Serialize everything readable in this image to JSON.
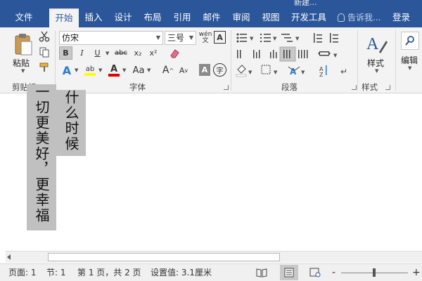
{
  "window": {
    "doc_title": "新建..."
  },
  "tabs": [
    {
      "label": "文件",
      "active": false
    },
    {
      "label": "开始",
      "active": true
    },
    {
      "label": "插入",
      "active": false
    },
    {
      "label": "设计",
      "active": false
    },
    {
      "label": "布局",
      "active": false
    },
    {
      "label": "引用",
      "active": false
    },
    {
      "label": "邮件",
      "active": false
    },
    {
      "label": "审阅",
      "active": false
    },
    {
      "label": "视图",
      "active": false
    },
    {
      "label": "开发工具",
      "active": false
    }
  ],
  "tell_me": {
    "text": "告诉我..."
  },
  "login": {
    "label": "登录"
  },
  "ribbon": {
    "clipboard": {
      "group_label": "剪贴板",
      "paste_label": "粘贴"
    },
    "font": {
      "group_label": "字体",
      "font_name": "仿宋",
      "font_size": "三号",
      "bold": "B",
      "italic": "I",
      "underline": "U",
      "strike": "abc",
      "subscript": "x₂",
      "superscript": "x²",
      "text_effect": "A",
      "highlight": "ab",
      "font_color": "A",
      "change_case": "Aa",
      "grow": "A",
      "shrink": "A",
      "char_shading": "A",
      "enclose": "字",
      "phonetic": "文"
    },
    "paragraph": {
      "group_label": "段落"
    },
    "styles": {
      "group_label": "样式",
      "styles_label": "样式"
    },
    "editing": {
      "editing_label": "编辑"
    }
  },
  "document": {
    "column_1": "一切更美好，更幸福",
    "column_2": "什么时候"
  },
  "status": {
    "page": "页面: 1",
    "section": "节: 1",
    "page_of": "第 1 页，共 2 页",
    "setting": "设置值: 3.1厘米",
    "zoom_minus": "-",
    "zoom_plus": "+"
  },
  "colors": {
    "accent": "#2b579a",
    "ribbon_bg": "#f3f3f3",
    "highlight_yellow": "#ffff00",
    "font_red": "#e00000",
    "text_selection": "#c0c0c0"
  }
}
